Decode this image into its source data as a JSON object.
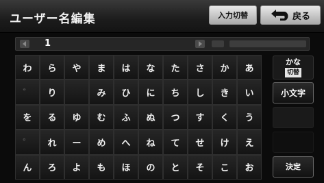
{
  "header": {
    "title": "ユーザー名編集",
    "input_switch_label": "入力切替",
    "back_label": "戻る"
  },
  "input": {
    "text": "1"
  },
  "keys": [
    [
      "わ",
      "ら",
      "や",
      "ま",
      "は",
      "な",
      "た",
      "さ",
      "か",
      "あ"
    ],
    [
      "゛",
      "り",
      "",
      "み",
      "ひ",
      "に",
      "ち",
      "し",
      "き",
      "い"
    ],
    [
      "を",
      "る",
      "ゆ",
      "む",
      "ふ",
      "ぬ",
      "つ",
      "す",
      "く",
      "う"
    ],
    [
      "゜",
      "れ",
      "ー",
      "め",
      "へ",
      "ね",
      "て",
      "せ",
      "け",
      "え"
    ],
    [
      "ん",
      "ろ",
      "よ",
      "も",
      "ほ",
      "の",
      "と",
      "そ",
      "こ",
      "お"
    ]
  ],
  "side": {
    "kana_line1": "かな",
    "kana_line2": "切替",
    "small_char": "小文字",
    "confirm": "決定"
  }
}
